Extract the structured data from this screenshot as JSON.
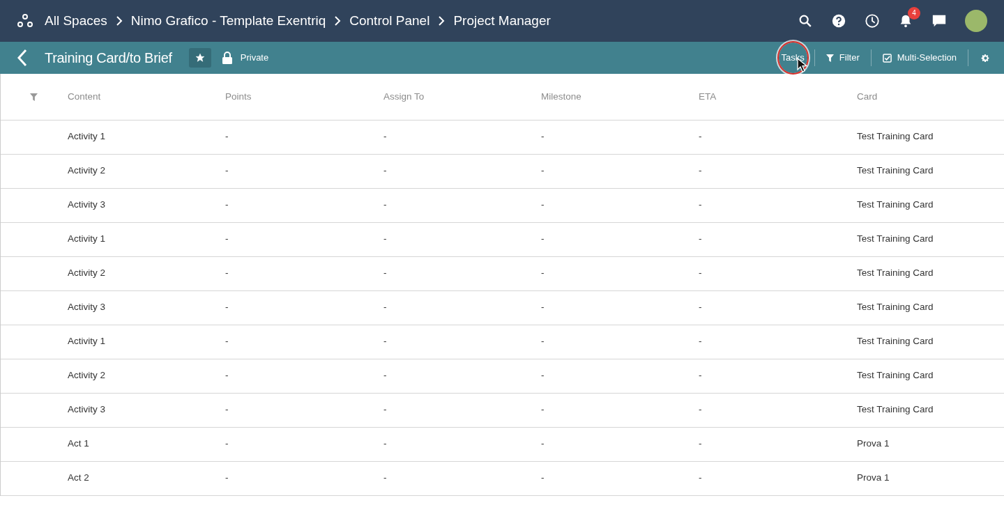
{
  "breadcrumbs": [
    "All Spaces",
    "Nimo Grafico - Template Exentriq",
    "Control Panel",
    "Project Manager"
  ],
  "notifications": {
    "count": "4"
  },
  "page_header": {
    "title": "Training Card/to Brief",
    "starred": true,
    "visibility": "Private"
  },
  "actions": [
    {
      "label": "Tasks",
      "kind": "plain",
      "highlighted": true
    },
    {
      "label": "Filter",
      "kind": "filter",
      "highlighted": false
    },
    {
      "label": "Multi-Selection",
      "kind": "toggle",
      "highlighted": false
    }
  ],
  "table": {
    "columns": [
      "Content",
      "Points",
      "Assign To",
      "Milestone",
      "ETA",
      "Card"
    ],
    "rows": [
      [
        "Activity 1",
        "-",
        "-",
        "-",
        "-",
        "Test Training Card"
      ],
      [
        "Activity 2",
        "-",
        "-",
        "-",
        "-",
        "Test Training Card"
      ],
      [
        "Activity 3",
        "-",
        "-",
        "-",
        "-",
        "Test Training Card"
      ],
      [
        "Activity 1",
        "-",
        "-",
        "-",
        "-",
        "Test Training Card"
      ],
      [
        "Activity 2",
        "-",
        "-",
        "-",
        "-",
        "Test Training Card"
      ],
      [
        "Activity 3",
        "-",
        "-",
        "-",
        "-",
        "Test Training Card"
      ],
      [
        "Activity 1",
        "-",
        "-",
        "-",
        "-",
        "Test Training Card"
      ],
      [
        "Activity 2",
        "-",
        "-",
        "-",
        "-",
        "Test Training Card"
      ],
      [
        "Activity 3",
        "-",
        "-",
        "-",
        "-",
        "Test Training Card"
      ],
      [
        "Act 1",
        "-",
        "-",
        "-",
        "-",
        "Prova 1"
      ],
      [
        "Act 2",
        "-",
        "-",
        "-",
        "-",
        "Prova 1"
      ]
    ]
  }
}
